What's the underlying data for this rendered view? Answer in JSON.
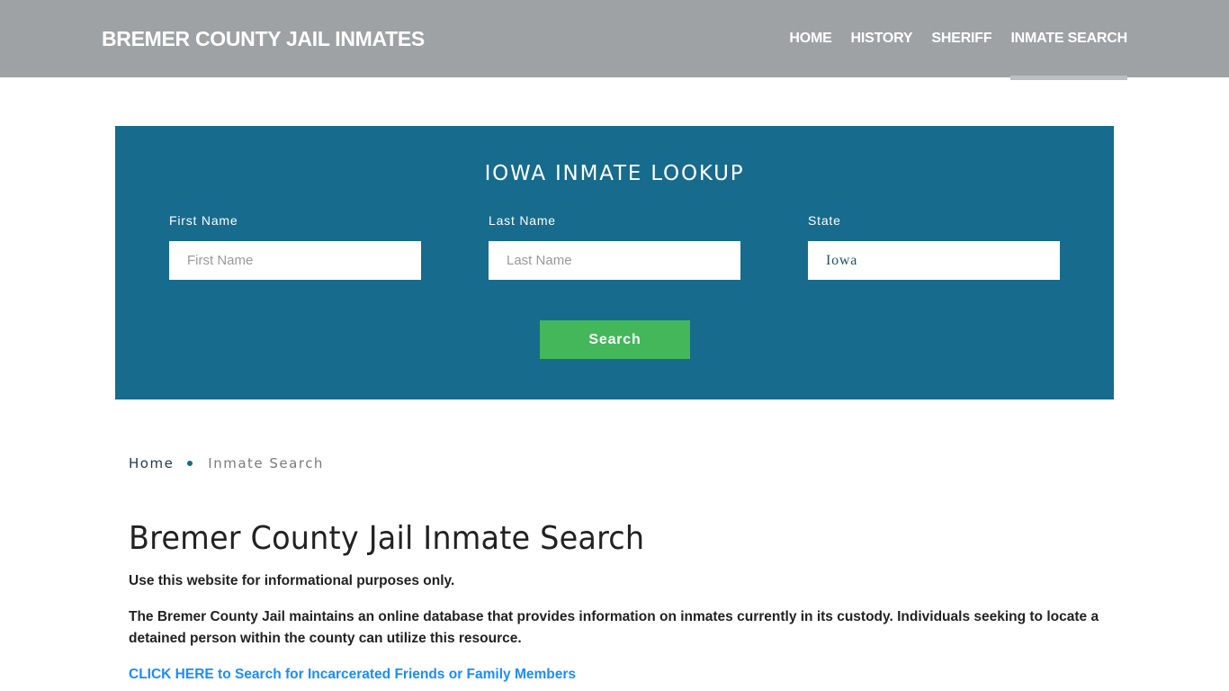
{
  "header": {
    "brand": "BREMER COUNTY JAIL INMATES",
    "nav": [
      {
        "label": "HOME",
        "active": false
      },
      {
        "label": "HISTORY",
        "active": false
      },
      {
        "label": "SHERIFF",
        "active": false
      },
      {
        "label": "INMATE SEARCH",
        "active": true
      }
    ]
  },
  "lookup": {
    "title": "IOWA INMATE LOOKUP",
    "fields": {
      "first_name": {
        "label": "First Name",
        "placeholder": "First Name",
        "value": ""
      },
      "last_name": {
        "label": "Last Name",
        "placeholder": "Last Name",
        "value": ""
      },
      "state": {
        "label": "State",
        "value": "Iowa"
      }
    },
    "search_label": "Search"
  },
  "breadcrumb": {
    "home": "Home",
    "current": "Inmate Search"
  },
  "content": {
    "title": "Bremer County Jail Inmate Search",
    "paragraph1": "Use this website for informational purposes only.",
    "paragraph2": "The Bremer County Jail maintains an online database that provides information on inmates currently in its custody. Individuals seeking to locate a detained person within the county can utilize this resource.",
    "cta_link": "CLICK HERE to Search for Incarcerated Friends or Family Members"
  },
  "colors": {
    "header_bg": "#9ea2a5",
    "lookup_bg": "#176b8d",
    "search_button": "#43b75a",
    "link": "#1a8cff"
  }
}
